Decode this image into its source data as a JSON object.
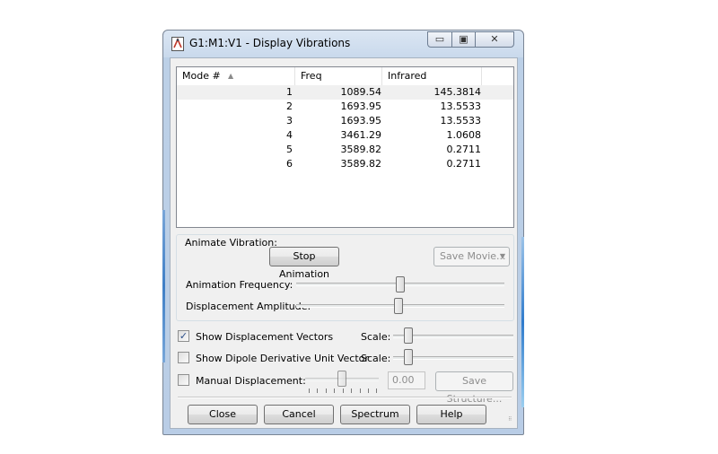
{
  "window": {
    "title": "G1:M1:V1 - Display Vibrations",
    "icons": {
      "app": "gaussview-app-icon",
      "minimize": "minimize-icon",
      "maximize": "maximize-icon",
      "close": "close-icon"
    }
  },
  "table": {
    "columns": [
      "Mode #",
      "Freq",
      "Infrared"
    ],
    "sort_indicator": "▲",
    "rows": [
      {
        "mode": "1",
        "freq": "1089.54",
        "infrared": "145.3814"
      },
      {
        "mode": "2",
        "freq": "1693.95",
        "infrared": "13.5533"
      },
      {
        "mode": "3",
        "freq": "1693.95",
        "infrared": "13.5533"
      },
      {
        "mode": "4",
        "freq": "3461.29",
        "infrared": "1.0608"
      },
      {
        "mode": "5",
        "freq": "3589.82",
        "infrared": "0.2711"
      },
      {
        "mode": "6",
        "freq": "3589.82",
        "infrared": "0.2711"
      }
    ],
    "selected_row": 1
  },
  "animate": {
    "group_label": "Animate Vibration:",
    "stop_button": "Stop Animation",
    "save_movie_button": "Save Movie...",
    "frequency_label": "Animation Frequency:",
    "frequency_level": 0.5,
    "amplitude_label": "Displacement Amplitude:",
    "amplitude_level": 0.49
  },
  "options": {
    "show_vectors_label": "Show Displacement Vectors",
    "show_vectors_checked": true,
    "vectors_scale_label": "Scale:",
    "vectors_scale_level": 0.1,
    "show_dipole_label": "Show Dipole Derivative Unit Vector",
    "show_dipole_checked": false,
    "dipole_scale_label": "Scale:",
    "dipole_scale_level": 0.1,
    "manual_label": "Manual Displacement:",
    "manual_checked": false,
    "manual_level": 0.5,
    "manual_value": "0.00",
    "save_structure_button": "Save Structure..."
  },
  "buttons": {
    "close": "Close",
    "cancel": "Cancel",
    "spectrum": "Spectrum",
    "help": "Help"
  }
}
